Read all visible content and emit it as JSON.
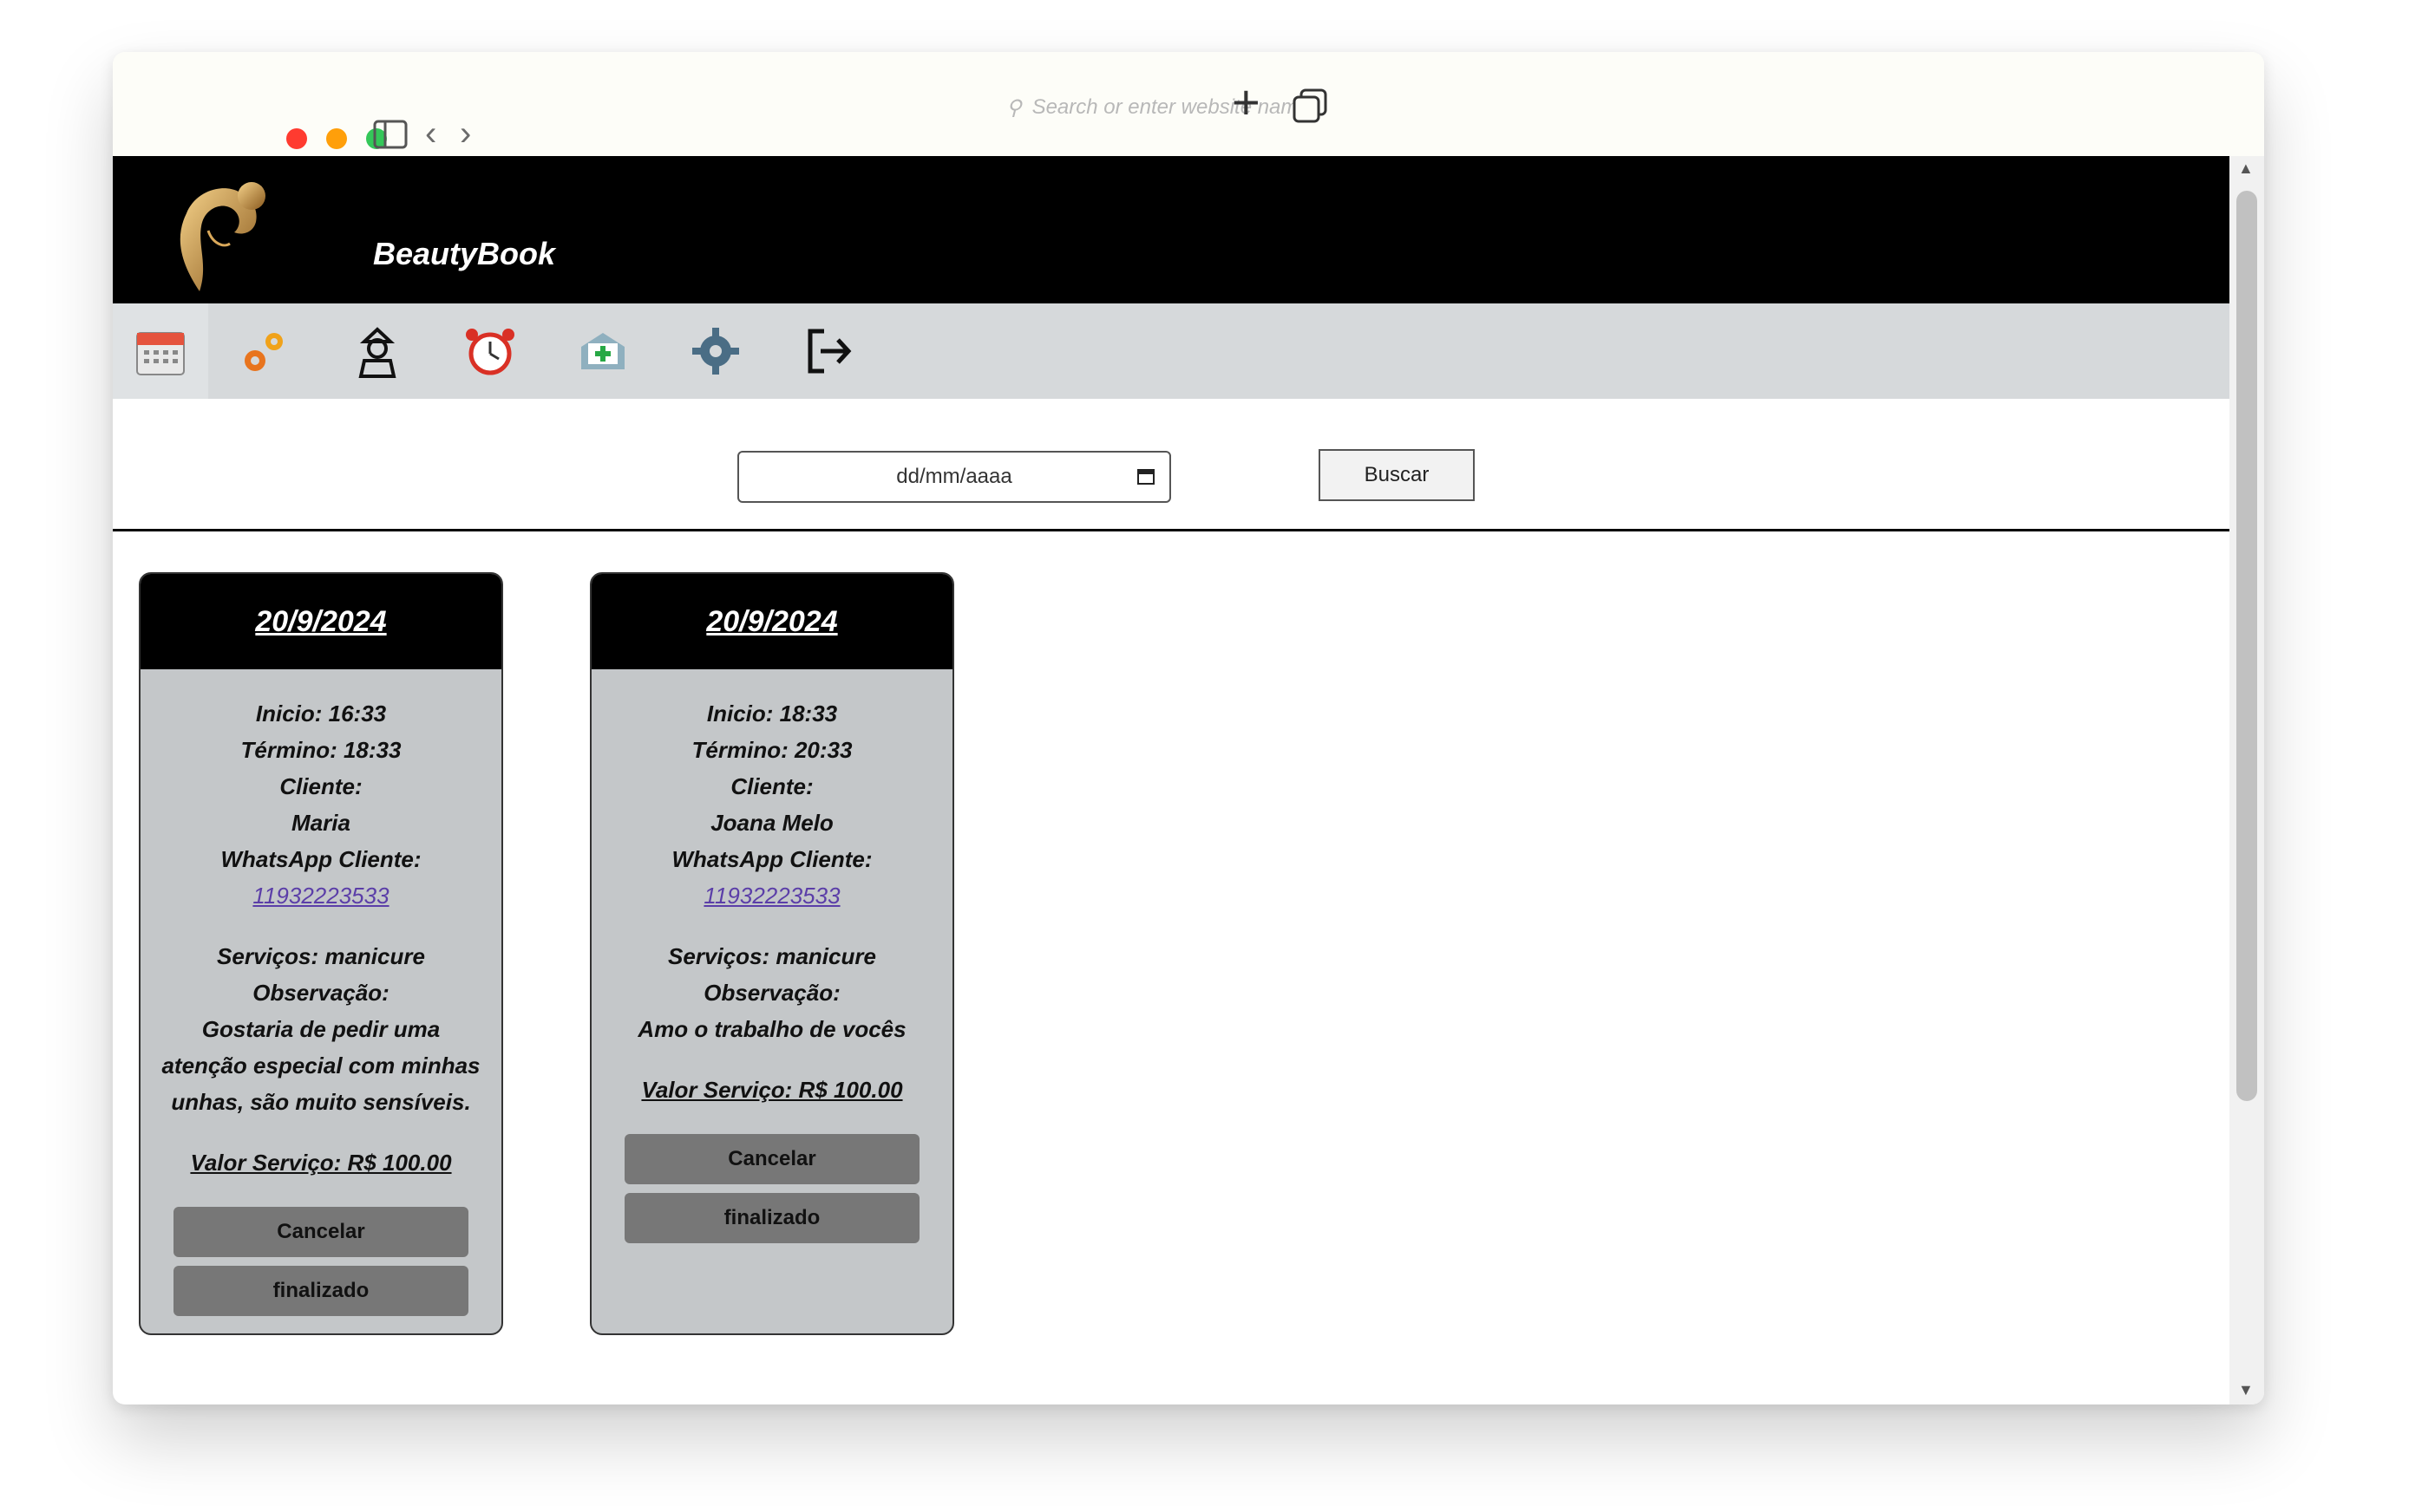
{
  "browser": {
    "address_placeholder": "Search or enter website name",
    "icons": [
      "sidebar-icon",
      "back-icon",
      "forward-icon",
      "new-tab-icon",
      "tabs-icon"
    ]
  },
  "app": {
    "brand": "BeautyBook"
  },
  "nav": {
    "items": [
      {
        "icon": "calendar-icon"
      },
      {
        "icon": "gears-icon"
      },
      {
        "icon": "professional-icon"
      },
      {
        "icon": "alarm-clock-icon"
      },
      {
        "icon": "medical-kit-icon"
      },
      {
        "icon": "settings-gear-icon"
      },
      {
        "icon": "logout-icon"
      }
    ]
  },
  "search": {
    "date_placeholder": "dd/mm/aaaa",
    "button_label": "Buscar"
  },
  "cards": [
    {
      "date": "20/9/2024",
      "start": "Inicio: 16:33",
      "end": "Término: 18:33",
      "client_label": "Cliente:",
      "client_name": "Maria",
      "whatsapp_label": "WhatsApp Cliente:",
      "phone": "11932223533",
      "services": "Serviços: manicure",
      "note_label": "Observação:",
      "note": "Gostaria de pedir uma atenção especial com minhas unhas, são muito sensíveis.",
      "value": "Valor Serviço: R$ 100.00",
      "cancel_label": "Cancelar",
      "finish_label": "finalizado"
    },
    {
      "date": "20/9/2024",
      "start": "Inicio: 18:33",
      "end": "Término: 20:33",
      "client_label": "Cliente:",
      "client_name": "Joana Melo",
      "whatsapp_label": "WhatsApp Cliente:",
      "phone": "11932223533",
      "services": "Serviços: manicure",
      "note_label": "Observação:",
      "note": "Amo o trabalho de vocês",
      "value": "Valor Serviço: R$ 100.00",
      "cancel_label": "Cancelar",
      "finish_label": "finalizado"
    }
  ],
  "colors": {
    "header_bg": "#000000",
    "nav_bg": "#d6d9db",
    "card_bg": "#c4c7c9",
    "button_bg": "#777777",
    "link": "#5b3ea8"
  }
}
